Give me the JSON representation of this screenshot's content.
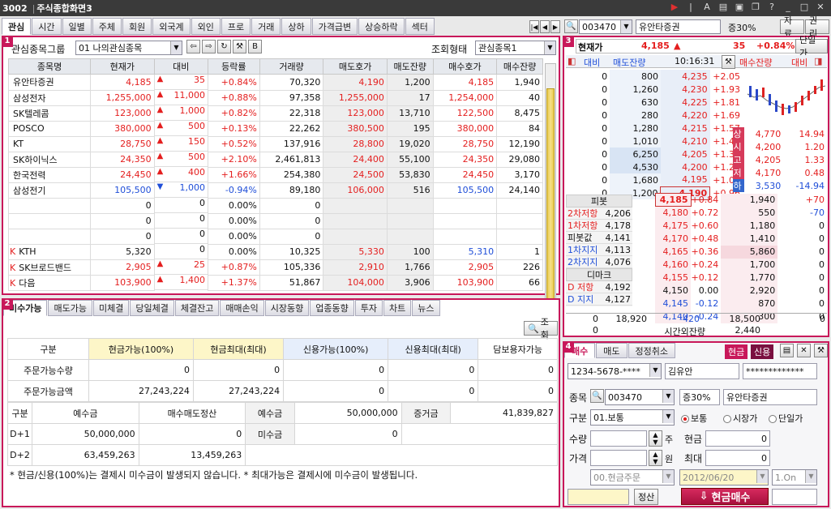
{
  "window": {
    "code": "3002",
    "title": "주식종합화면3"
  },
  "top_tabs": [
    "관심",
    "시간",
    "일별",
    "주체",
    "회원",
    "외국계",
    "외인",
    "프로",
    "거래",
    "상하",
    "가격급변",
    "상승하락",
    "섹터"
  ],
  "p1": {
    "num": "1",
    "group_label": "관심종목그룹",
    "group_value": "01 나의관심종목",
    "view_label": "조회형태",
    "view_value": "관심종목1",
    "headers": [
      "종목명",
      "현재가",
      "대비",
      "등락률",
      "거래량",
      "매도호가",
      "매도잔량",
      "매수호가",
      "매수잔량"
    ],
    "rows": [
      {
        "k": "",
        "name": "유안타증권",
        "price": "4,185",
        "tri": "▲",
        "chg": "35",
        "rate": "+0.84%",
        "vol": "70,320",
        "ask": "4,190",
        "askq": "1,200",
        "bid": "4,185",
        "bidq": "1,940",
        "c": "up"
      },
      {
        "k": "",
        "name": "삼성전자",
        "price": "1,255,000",
        "tri": "▲",
        "chg": "11,000",
        "rate": "+0.88%",
        "vol": "97,358",
        "ask": "1,255,000",
        "askq": "17",
        "bid": "1,254,000",
        "bidq": "40",
        "c": "up"
      },
      {
        "k": "",
        "name": "SK텔레콤",
        "price": "123,000",
        "tri": "▲",
        "chg": "1,000",
        "rate": "+0.82%",
        "vol": "22,318",
        "ask": "123,000",
        "askq": "13,710",
        "bid": "122,500",
        "bidq": "8,475",
        "c": "up"
      },
      {
        "k": "",
        "name": "POSCO",
        "price": "380,000",
        "tri": "▲",
        "chg": "500",
        "rate": "+0.13%",
        "vol": "22,262",
        "ask": "380,500",
        "askq": "195",
        "bid": "380,000",
        "bidq": "84",
        "c": "up"
      },
      {
        "k": "",
        "name": "KT",
        "price": "28,750",
        "tri": "▲",
        "chg": "150",
        "rate": "+0.52%",
        "vol": "137,916",
        "ask": "28,800",
        "askq": "19,020",
        "bid": "28,750",
        "bidq": "12,190",
        "c": "up"
      },
      {
        "k": "",
        "name": "SK하이닉스",
        "price": "24,350",
        "tri": "▲",
        "chg": "500",
        "rate": "+2.10%",
        "vol": "2,461,813",
        "ask": "24,400",
        "askq": "55,100",
        "bid": "24,350",
        "bidq": "29,080",
        "c": "up"
      },
      {
        "k": "",
        "name": "한국전력",
        "price": "24,450",
        "tri": "▲",
        "chg": "400",
        "rate": "+1.66%",
        "vol": "254,380",
        "ask": "24,500",
        "askq": "53,830",
        "bid": "24,450",
        "bidq": "3,170",
        "c": "up"
      },
      {
        "k": "",
        "name": "삼성전기",
        "price": "105,500",
        "tri": "▼",
        "chg": "1,000",
        "rate": "-0.94%",
        "vol": "89,180",
        "ask": "106,000",
        "askq": "516",
        "bid": "105,500",
        "bidq": "24,140",
        "c": "dn"
      },
      {
        "k": "",
        "name": "",
        "price": "0",
        "tri": "",
        "chg": "0",
        "rate": "0.00%",
        "vol": "0",
        "ask": "",
        "askq": "",
        "bid": "",
        "bidq": "",
        "c": ""
      },
      {
        "k": "",
        "name": "",
        "price": "0",
        "tri": "",
        "chg": "0",
        "rate": "0.00%",
        "vol": "0",
        "ask": "",
        "askq": "",
        "bid": "",
        "bidq": "",
        "c": ""
      },
      {
        "k": "",
        "name": "",
        "price": "0",
        "tri": "",
        "chg": "0",
        "rate": "0.00%",
        "vol": "0",
        "ask": "",
        "askq": "",
        "bid": "",
        "bidq": "",
        "c": ""
      },
      {
        "k": "K",
        "name": "KTH",
        "price": "5,320",
        "tri": "",
        "chg": "0",
        "rate": "0.00%",
        "vol": "10,325",
        "ask": "5,330",
        "askq": "100",
        "bid": "5,310",
        "bidq": "1",
        "c": ""
      },
      {
        "k": "K",
        "name": "SK브로드밴드",
        "price": "2,905",
        "tri": "▲",
        "chg": "25",
        "rate": "+0.87%",
        "vol": "105,336",
        "ask": "2,910",
        "askq": "1,766",
        "bid": "2,905",
        "bidq": "226",
        "c": "up"
      },
      {
        "k": "K",
        "name": "다음",
        "price": "103,900",
        "tri": "▲",
        "chg": "1,400",
        "rate": "+1.37%",
        "vol": "51,867",
        "ask": "104,000",
        "askq": "3,906",
        "bid": "103,900",
        "bidq": "66",
        "c": "up"
      }
    ]
  },
  "p2": {
    "num": "2",
    "tabs": [
      "미수가능",
      "매도가능",
      "미체결",
      "당일체결",
      "체결잔고",
      "매매손익",
      "시장동향",
      "업종동향",
      "투자",
      "차트",
      "뉴스"
    ],
    "search": "조회",
    "head": [
      "구분",
      "현금가능(100%)",
      "현금최대(최대)",
      "신용가능(100%)",
      "신용최대(최대)",
      "담보용자가능"
    ],
    "r1": [
      "주문가능수량",
      "0",
      "0",
      "0",
      "0",
      "0"
    ],
    "r2": [
      "주문가능금액",
      "27,243,224",
      "27,243,224",
      "0",
      "0",
      "0"
    ],
    "b_head": [
      "구분",
      "예수금",
      "매수매도정산",
      "예수금",
      "50,000,000",
      "증거금",
      "41,839,827"
    ],
    "b_r1": [
      "D+1",
      "50,000,000",
      "0",
      "미수금",
      "0"
    ],
    "b_r2": [
      "D+2",
      "63,459,263",
      "13,459,263"
    ],
    "note": "* 현금/신용(100%)는 결제시 미수금이 발생되지 않습니다. * 최대가능은 결제시에 미수금이 발생됩니다."
  },
  "p3": {
    "num": "3",
    "code": "003470",
    "name": "유안타증권",
    "margin": "증30%",
    "btn1": "자료",
    "btn2": "권리",
    "price_label": "현재가",
    "price": "4,185",
    "tri": "▲",
    "chg": "35",
    "rate": "+0.84%",
    "single": "단일가",
    "h_left": "대비",
    "h_left2": "매도잔량",
    "time": "10:16:31",
    "h_right": "매수잔량",
    "h_right2": "대비",
    "asks": [
      [
        "0",
        "800",
        "4,235",
        "+2.05"
      ],
      [
        "0",
        "1,260",
        "4,230",
        "+1.93"
      ],
      [
        "0",
        "630",
        "4,225",
        "+1.81"
      ],
      [
        "0",
        "280",
        "4,220",
        "+1.69"
      ],
      [
        "0",
        "1,280",
        "4,215",
        "+1.57"
      ],
      [
        "0",
        "1,010",
        "4,210",
        "+1.45"
      ],
      [
        "0",
        "6,250",
        "4,205",
        "+1.33"
      ],
      [
        "0",
        "4,530",
        "4,200",
        "+1.20"
      ],
      [
        "0",
        "1,680",
        "4,195",
        "+1.08"
      ],
      [
        "0",
        "1,200",
        "4,190",
        "+0.96"
      ]
    ],
    "bids": [
      [
        "4,185",
        "+0.84",
        "1,940",
        "+70"
      ],
      [
        "4,180",
        "+0.72",
        "550",
        "-70"
      ],
      [
        "4,175",
        "+0.60",
        "1,180",
        "0"
      ],
      [
        "4,170",
        "+0.48",
        "1,410",
        "0"
      ],
      [
        "4,165",
        "+0.36",
        "5,860",
        "0"
      ],
      [
        "4,160",
        "+0.24",
        "1,700",
        "0"
      ],
      [
        "4,155",
        "+0.12",
        "1,770",
        "0"
      ],
      [
        "4,150",
        "0.00",
        "2,920",
        "0"
      ],
      [
        "4,145",
        "-0.12",
        "870",
        "0"
      ],
      [
        "4,140",
        "-0.24",
        "300",
        "0"
      ]
    ],
    "stats": [
      [
        "상",
        "4,770",
        "14.94"
      ],
      [
        "시",
        "4,200",
        "1.20"
      ],
      [
        "고",
        "4,205",
        "1.33"
      ],
      [
        "저",
        "4,170",
        "0.48"
      ],
      [
        "하",
        "3,530",
        "-14.94"
      ]
    ],
    "pivot_title": "피봇",
    "pivot": [
      [
        "2차저항",
        "4,206"
      ],
      [
        "1차저항",
        "4,178"
      ],
      [
        "피봇값",
        "4,141"
      ],
      [
        "1차지지",
        "4,113"
      ],
      [
        "2차지지",
        "4,076"
      ]
    ],
    "demark_title": "디마크",
    "demark": [
      [
        "D 저항",
        "4,192"
      ],
      [
        "D 지지",
        "4,127"
      ]
    ],
    "sum": [
      "0",
      "18,920",
      "-420",
      "18,500",
      "0"
    ],
    "after": [
      "0",
      "시간외잔량",
      "2,440"
    ]
  },
  "p4": {
    "num": "4",
    "tabs": [
      "매수",
      "매도",
      "정정취소"
    ],
    "cash": "현금",
    "credit": "신용",
    "account": "1234-5678-****",
    "owner": "김유안",
    "pw": "*************",
    "lbl_stock": "종목",
    "code": "003470",
    "margin": "증30%",
    "name": "유안타증권",
    "lbl_type": "구분",
    "type": "01.보통",
    "r_normal": "보통",
    "r_market": "시장가",
    "r_single": "단일가",
    "lbl_qty": "수량",
    "qty_unit": "주",
    "lbl_price": "가격",
    "price_unit": "원",
    "cash_lbl": "현금",
    "cash_val": "0",
    "max_lbl": "최대",
    "max_val": "0",
    "order_type": "00.현금주문",
    "date": "2012/06/20",
    "on": "1.On",
    "settle": "정산",
    "buy_btn": "현금매수"
  }
}
